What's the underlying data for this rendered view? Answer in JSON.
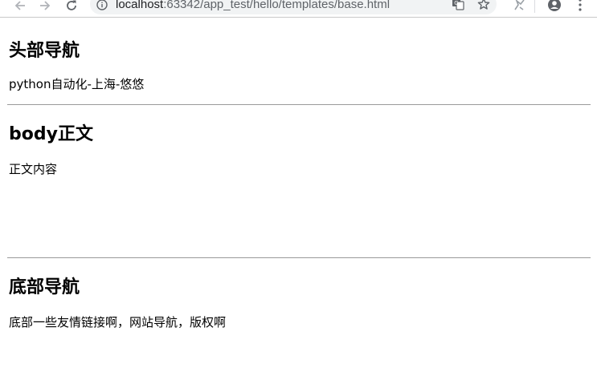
{
  "browser": {
    "url_host": "localhost",
    "url_path": ":63342/app_test/hello/templates/base.html"
  },
  "header": {
    "title": "头部导航",
    "text": "python自动化-上海-悠悠"
  },
  "body_section": {
    "title": "body正文",
    "text": "正文内容"
  },
  "footer": {
    "title": "底部导航",
    "text": "底部一些友情链接啊，网站导航，版权啊"
  },
  "icons": {
    "back": "arrow-left-icon",
    "forward": "arrow-right-icon",
    "reload": "reload-icon",
    "info": "info-icon",
    "translate": "translate-icon",
    "bookmark": "star-icon",
    "extension": "extension-icon",
    "account": "account-icon",
    "menu": "vertical-dots-icon"
  },
  "colors": {
    "divider": "#9a9a9a",
    "omnibox_bg": "#f1f3f4",
    "icon": "#5f6368"
  }
}
